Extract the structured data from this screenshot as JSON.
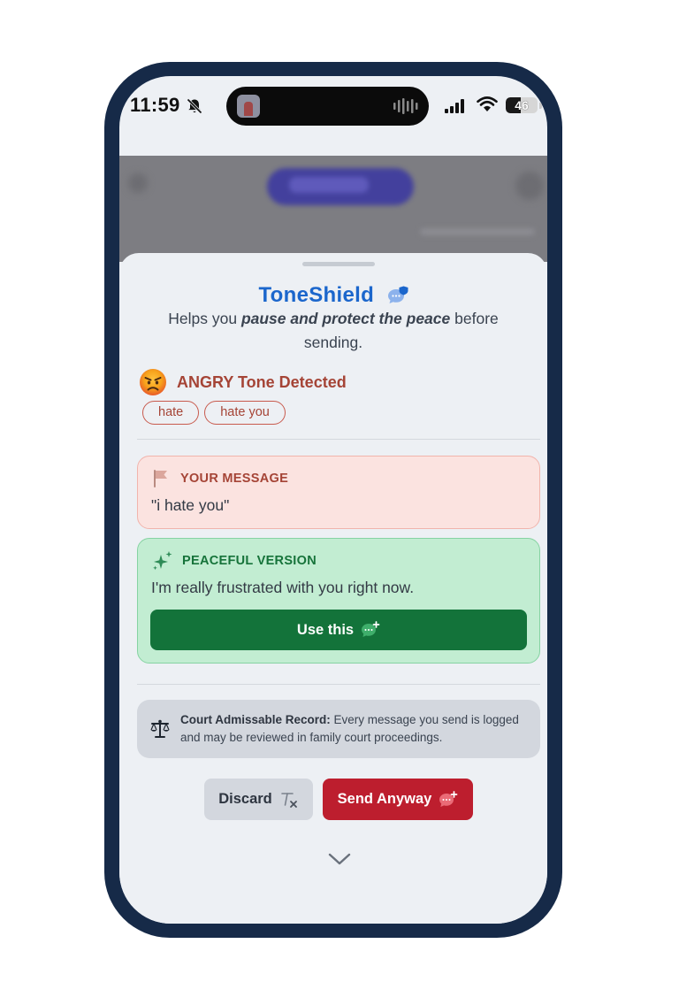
{
  "status_bar": {
    "time": "11:59",
    "battery": "46",
    "battery_level": 0.46,
    "icons": [
      "bell-slash-icon",
      "cellular-signal-icon",
      "wifi-icon",
      "battery-icon"
    ]
  },
  "sheet": {
    "title": "ToneShield",
    "title_icon": "chat-shield-icon",
    "subtitle_prefix": "Helps you ",
    "subtitle_emphasis": "pause and protect the peace",
    "subtitle_suffix": " before sending.",
    "tone": {
      "emoji": "angry-face-icon",
      "label": "ANGRY Tone Detected",
      "color": "#a54436",
      "keywords": [
        "hate",
        "hate you"
      ]
    },
    "your_message": {
      "icon": "flag-icon",
      "heading": "YOUR MESSAGE",
      "text": "\"i hate you\""
    },
    "peaceful_version": {
      "icon": "sparkles-icon",
      "heading": "PEACEFUL VERSION",
      "text": "I'm really frustrated with you right now.",
      "button_label": "Use this",
      "button_icon": "chat-bubble-plus-icon",
      "button_color": "#13733a"
    },
    "court_notice": {
      "icon": "scale-icon",
      "bold": "Court Admissable Record:",
      "text": " Every message you send is logged and may be reviewed in family court proceedings."
    },
    "actions": {
      "discard_label": "Discard",
      "discard_icon": "clear-format-icon",
      "send_label": "Send Anyway",
      "send_icon": "chat-bubble-plus-icon",
      "send_color": "#bd1e2e"
    },
    "collapse_icon": "chevron-down-icon"
  }
}
